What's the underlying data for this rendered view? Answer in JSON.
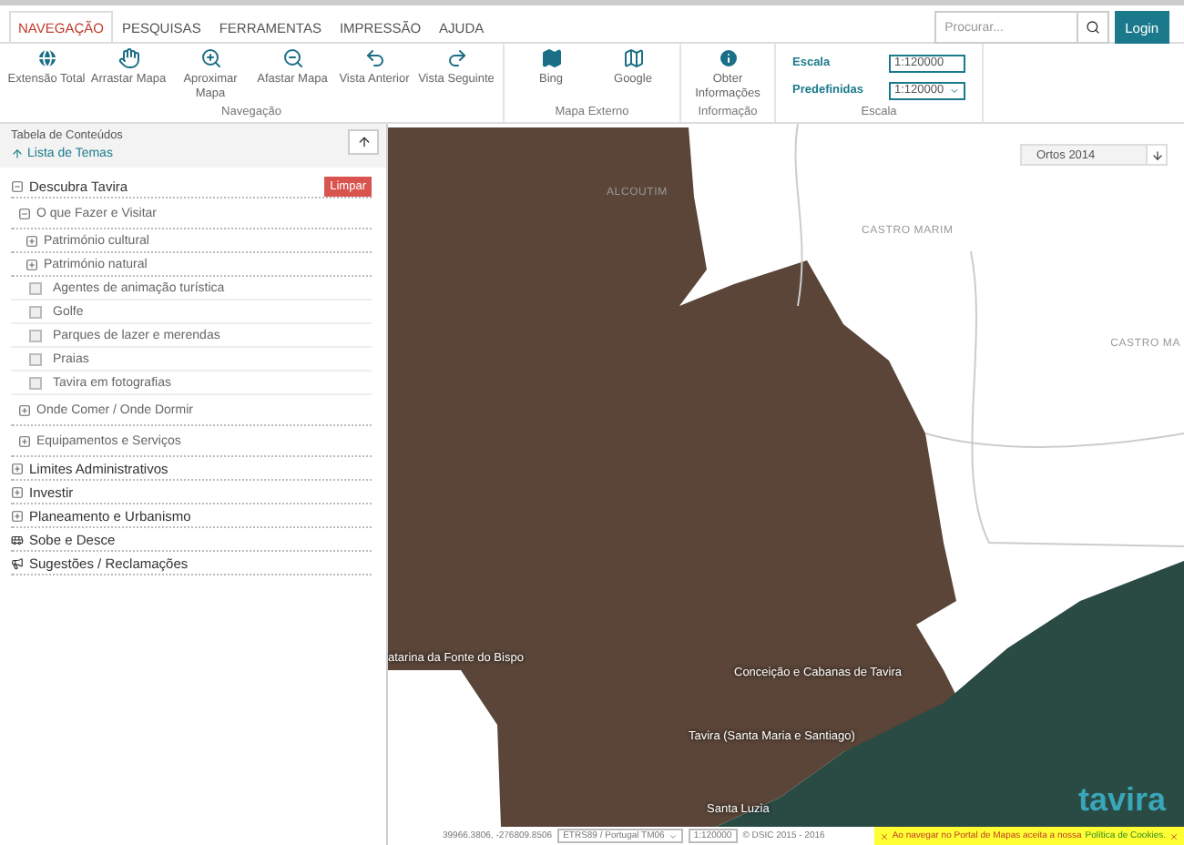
{
  "menu_tabs": [
    {
      "label": "NAVEGAÇÃO",
      "selected": true
    },
    {
      "label": "PESQUISAS",
      "selected": false
    },
    {
      "label": "FERRAMENTAS",
      "selected": false
    },
    {
      "label": "IMPRESSÃO",
      "selected": false
    },
    {
      "label": "AJUDA",
      "selected": false
    }
  ],
  "search": {
    "placeholder": "Procurar..."
  },
  "login_button": "Login",
  "ribbon_groups": [
    {
      "title": "Navegação",
      "kind": "buttons",
      "buttons": [
        {
          "kind": "globe",
          "label": "Extensão Total"
        },
        {
          "kind": "hand",
          "label": "Arrastar Mapa"
        },
        {
          "kind": "zoom-in",
          "label": "Aproximar Mapa"
        },
        {
          "kind": "zoom-out",
          "label": "Afastar Mapa"
        },
        {
          "kind": "back",
          "label": "Vista Anterior"
        },
        {
          "kind": "forward",
          "label": "Vista Seguinte"
        }
      ]
    },
    {
      "title": "Mapa Externo",
      "kind": "buttons",
      "buttons": [
        {
          "kind": "map-filled",
          "label": "Bing"
        },
        {
          "kind": "map-outline",
          "label": "Google"
        }
      ]
    },
    {
      "title": "Informação",
      "kind": "buttons",
      "buttons": [
        {
          "kind": "info",
          "label": "Obter Informações"
        }
      ]
    },
    {
      "title": "Escala",
      "kind": "scale",
      "scale_label": "Escala",
      "scale_value": "1:120000",
      "preset_label": "Predefinidas",
      "preset_value": "1:120000"
    }
  ],
  "toc": {
    "title": "Tabela de Conteúdos",
    "link": "Lista de Temas",
    "clear_button": "Limpar"
  },
  "themes": [
    {
      "kind": "folder",
      "label": "Descubra Tavira",
      "expanded": true,
      "children": [
        {
          "kind": "folder",
          "label": "O que Fazer e Visitar",
          "expanded": true,
          "children": [
            {
              "kind": "folder",
              "label": "Património cultural",
              "expanded": false
            },
            {
              "kind": "folder",
              "label": "Património natural",
              "expanded": false
            },
            {
              "kind": "layer",
              "label": "Agentes de animação turística",
              "checked": false
            },
            {
              "kind": "layer",
              "label": "Golfe",
              "checked": false
            },
            {
              "kind": "layer",
              "label": "Parques de lazer e merendas",
              "checked": false
            },
            {
              "kind": "layer",
              "label": "Praias",
              "checked": false
            },
            {
              "kind": "layer",
              "label": "Tavira em fotografias",
              "checked": false
            }
          ]
        },
        {
          "kind": "folder",
          "label": "Onde Comer / Onde Dormir",
          "expanded": false
        },
        {
          "kind": "folder",
          "label": "Equipamentos e Serviços",
          "expanded": false
        }
      ]
    },
    {
      "kind": "folder",
      "label": "Limites Administrativos",
      "expanded": false
    },
    {
      "kind": "folder",
      "label": "Investir",
      "expanded": false
    },
    {
      "kind": "folder",
      "label": "Planeamento e Urbanismo",
      "expanded": false
    },
    {
      "kind": "bus",
      "label": "Sobe e Desce"
    },
    {
      "kind": "megaphone",
      "label": "Sugestões / Reclamações"
    }
  ],
  "basemap_select": "Ortos 2014",
  "map_labels": [
    {
      "text": "ALCOUTIM",
      "kind": "region"
    },
    {
      "text": "CASTRO MARIM",
      "kind": "region"
    },
    {
      "text": "CASTRO MA",
      "kind": "region"
    },
    {
      "text": "atarina da Fonte do Bispo",
      "kind": "place"
    },
    {
      "text": "Conceição e Cabanas de Tavira",
      "kind": "place"
    },
    {
      "text": "Tavira (Santa Maria e Santiago)",
      "kind": "place"
    },
    {
      "text": "Santa Luzia",
      "kind": "place"
    }
  ],
  "logo": "tavira",
  "status_bar": {
    "coordinates": "39966.3806, -276809.8506",
    "projection": "ETRS89 / Portugal TM06",
    "scale": "1:120000",
    "copyright": "© DSIC 2015 - 2016",
    "cookie_notice": "Ao navegar no Portal de Mapas aceita a nossa",
    "cookie_link": "Política de Cookies."
  }
}
